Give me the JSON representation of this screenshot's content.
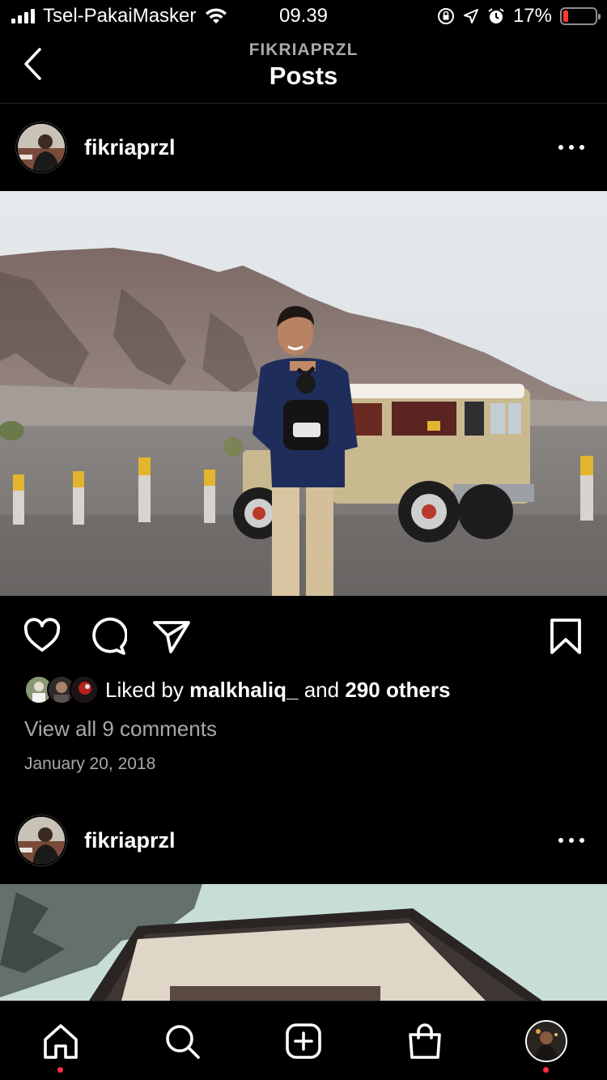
{
  "status_bar": {
    "carrier": "Tsel-PakaiMasker",
    "time": "09.39",
    "battery_percent": "17%",
    "battery_level": 0.17,
    "battery_color": "#ff3b30"
  },
  "header": {
    "subtitle": "FIKRIAPRZL",
    "title": "Posts",
    "back_icon": "chevron-left-icon"
  },
  "posts": [
    {
      "username": "fikriaprzl",
      "liked_by_prefix": "Liked by",
      "liked_by_user": "malkhaliq_",
      "liked_by_and": "and",
      "liked_by_others": "290 others",
      "view_comments": "View all 9 comments",
      "date": "January 20, 2018"
    },
    {
      "username": "fikriaprzl"
    }
  ],
  "actions": {
    "like_icon": "heart-icon",
    "comment_icon": "comment-icon",
    "share_icon": "send-icon",
    "save_icon": "bookmark-icon"
  },
  "tab_bar": {
    "items": [
      "home-icon",
      "search-icon",
      "create-icon",
      "shop-icon",
      "profile-avatar"
    ],
    "notification_color": "#ff3040"
  }
}
